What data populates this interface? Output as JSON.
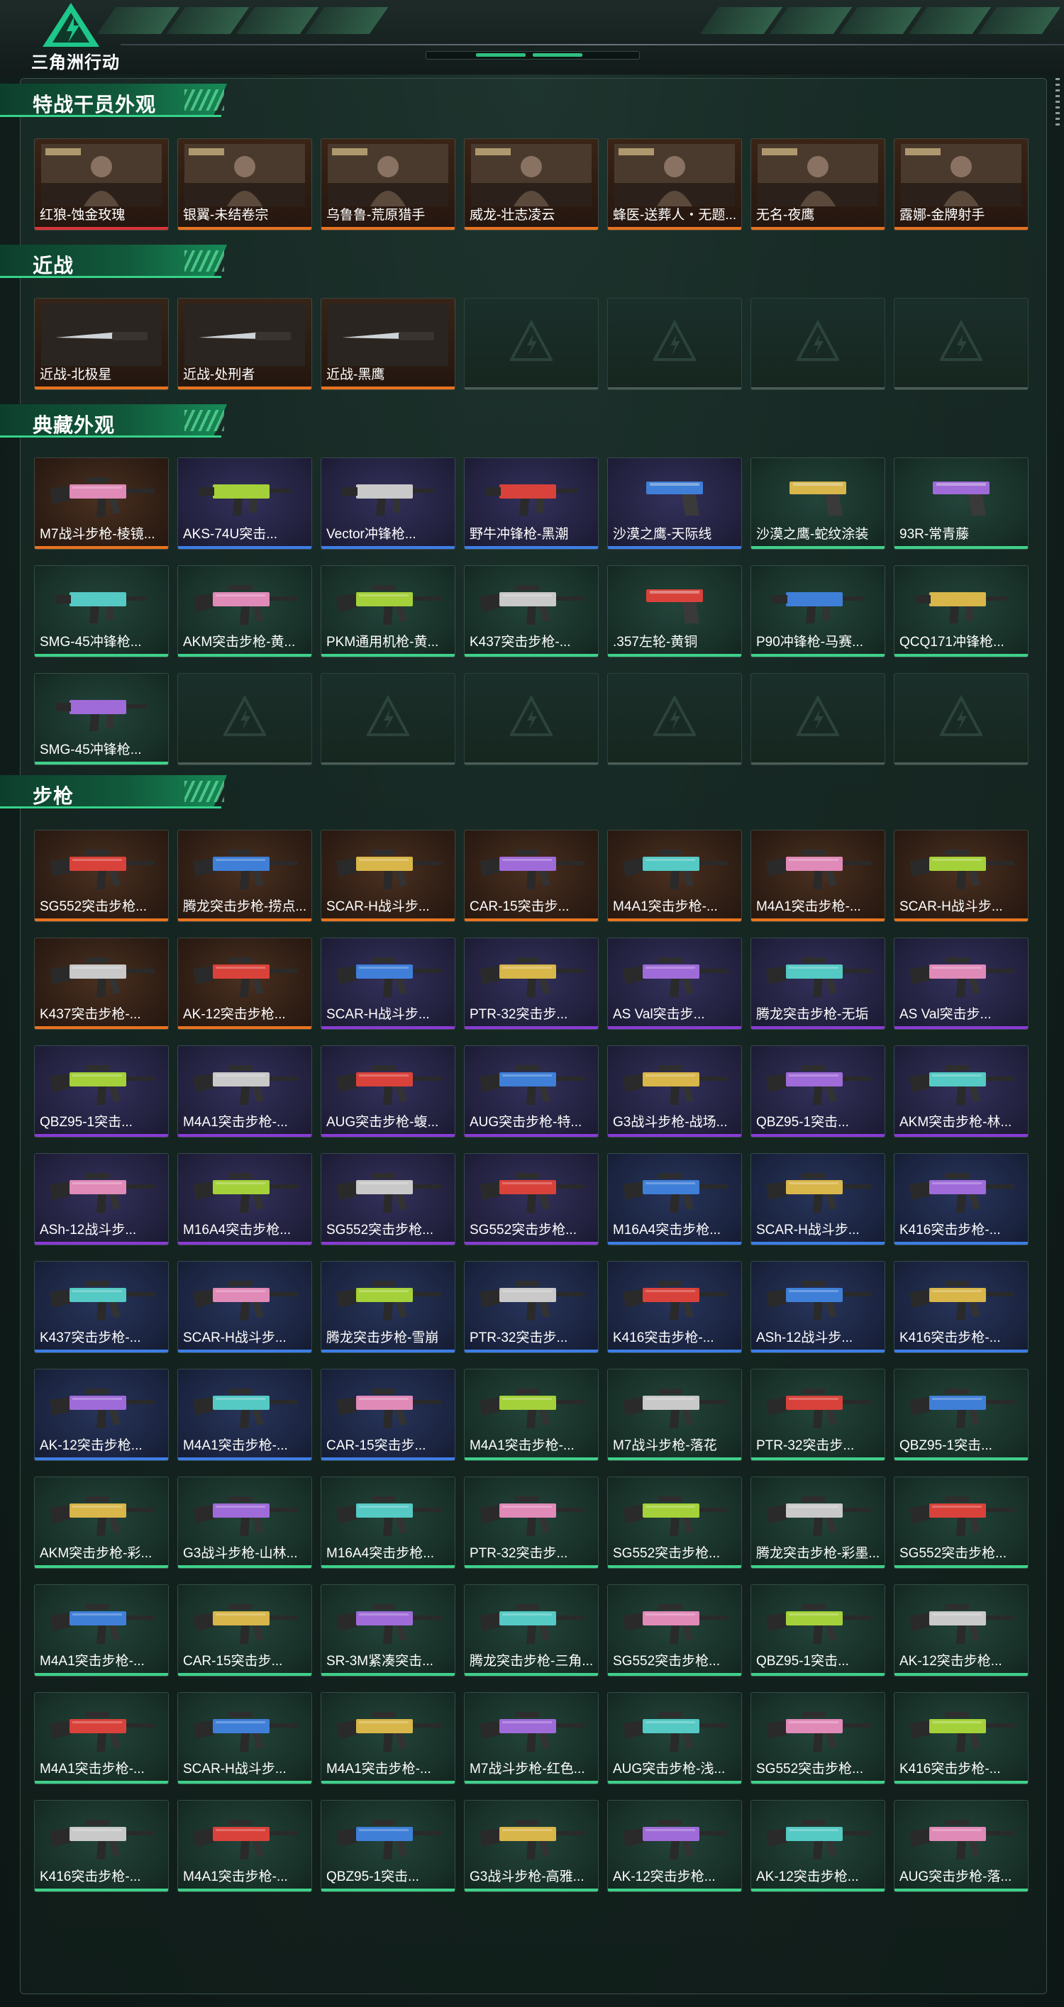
{
  "app": {
    "title": "三角洲行动"
  },
  "colors": {
    "gold": "#e8731f",
    "purple": "#8a3bd4",
    "blue": "#3d7ee6",
    "green": "#3fd08a",
    "red": "#d8343b"
  },
  "sections": [
    {
      "title": "特战干员外观",
      "items": [
        {
          "label": "红狼-蚀金玫瑰",
          "rarity": "red",
          "bg": "ops",
          "icon": "operator-portrait-icon"
        },
        {
          "label": "银翼-未结卷宗",
          "rarity": "gold",
          "bg": "ops",
          "icon": "operator-portrait-icon"
        },
        {
          "label": "乌鲁鲁-荒原猎手",
          "rarity": "gold",
          "bg": "ops",
          "icon": "operator-portrait-icon"
        },
        {
          "label": "威龙-壮志凌云",
          "rarity": "gold",
          "bg": "ops",
          "icon": "operator-portrait-icon"
        },
        {
          "label": "蜂医-送葬人・无题...",
          "rarity": "gold",
          "bg": "ops",
          "icon": "operator-portrait-icon"
        },
        {
          "label": "无名-夜鹰",
          "rarity": "gold",
          "bg": "ops",
          "icon": "operator-portrait-icon"
        },
        {
          "label": "露娜-金牌射手",
          "rarity": "gold",
          "bg": "ops",
          "icon": "operator-portrait-icon"
        }
      ]
    },
    {
      "title": "近战",
      "items": [
        {
          "label": "近战-北极星",
          "rarity": "gold",
          "bg": "melee",
          "icon": "knife-icon"
        },
        {
          "label": "近战-处刑者",
          "rarity": "gold",
          "bg": "melee",
          "icon": "knife-icon"
        },
        {
          "label": "近战-黑鹰",
          "rarity": "gold",
          "bg": "melee",
          "icon": "knife-icon"
        },
        {
          "empty": true
        },
        {
          "empty": true
        },
        {
          "empty": true
        },
        {
          "empty": true
        }
      ]
    },
    {
      "title": "典藏外观",
      "items": [
        {
          "label": "M7战斗步枪-棱镜...",
          "rarity": "gold",
          "bg": "gold",
          "icon": "rifle-icon"
        },
        {
          "label": "AKS-74U突击...",
          "rarity": "blue",
          "bg": "purple",
          "icon": "smg-icon"
        },
        {
          "label": "Vector冲锋枪...",
          "rarity": "blue",
          "bg": "purple",
          "icon": "smg-icon"
        },
        {
          "label": "野牛冲锋枪-黑潮",
          "rarity": "blue",
          "bg": "purple",
          "icon": "smg-icon"
        },
        {
          "label": "沙漠之鹰-天际线",
          "rarity": "blue",
          "bg": "purple",
          "icon": "pistol-icon"
        },
        {
          "label": "沙漠之鹰-蛇纹涂装",
          "rarity": "green",
          "bg": "green",
          "icon": "pistol-icon"
        },
        {
          "label": "93R-常青藤",
          "rarity": "green",
          "bg": "green",
          "icon": "pistol-icon"
        },
        {
          "label": "SMG-45冲锋枪...",
          "rarity": "green",
          "bg": "green",
          "icon": "smg-icon"
        },
        {
          "label": "AKM突击步枪-黄...",
          "rarity": "green",
          "bg": "green",
          "icon": "rifle-icon"
        },
        {
          "label": "PKM通用机枪-黄...",
          "rarity": "green",
          "bg": "green",
          "icon": "rifle-icon"
        },
        {
          "label": "K437突击步枪-...",
          "rarity": "green",
          "bg": "green",
          "icon": "rifle-icon"
        },
        {
          "label": ".357左轮-黄铜",
          "rarity": "green",
          "bg": "green",
          "icon": "revolver-icon"
        },
        {
          "label": "P90冲锋枪-马赛...",
          "rarity": "green",
          "bg": "green",
          "icon": "smg-icon"
        },
        {
          "label": "QCQ171冲锋枪...",
          "rarity": "green",
          "bg": "green",
          "icon": "smg-icon"
        },
        {
          "label": "SMG-45冲锋枪...",
          "rarity": "green",
          "bg": "green",
          "icon": "smg-icon"
        },
        {
          "empty": true
        },
        {
          "empty": true
        },
        {
          "empty": true
        },
        {
          "empty": true
        },
        {
          "empty": true
        },
        {
          "empty": true
        }
      ]
    },
    {
      "title": "步枪",
      "items": [
        {
          "label": "SG552突击步枪...",
          "rarity": "gold",
          "bg": "gold",
          "icon": "rifle-icon"
        },
        {
          "label": "腾龙突击步枪-捞点...",
          "rarity": "gold",
          "bg": "gold",
          "icon": "rifle-icon"
        },
        {
          "label": "SCAR-H战斗步...",
          "rarity": "gold",
          "bg": "gold",
          "icon": "rifle-icon"
        },
        {
          "label": "CAR-15突击步...",
          "rarity": "gold",
          "bg": "gold",
          "icon": "rifle-icon"
        },
        {
          "label": "M4A1突击步枪-...",
          "rarity": "gold",
          "bg": "gold",
          "icon": "rifle-icon"
        },
        {
          "label": "M4A1突击步枪-...",
          "rarity": "gold",
          "bg": "gold",
          "icon": "rifle-icon"
        },
        {
          "label": "SCAR-H战斗步...",
          "rarity": "gold",
          "bg": "gold",
          "icon": "rifle-icon"
        },
        {
          "label": "K437突击步枪-...",
          "rarity": "gold",
          "bg": "gold",
          "icon": "rifle-icon"
        },
        {
          "label": "AK-12突击步枪...",
          "rarity": "gold",
          "bg": "gold",
          "icon": "rifle-icon"
        },
        {
          "label": "SCAR-H战斗步...",
          "rarity": "purple",
          "bg": "purple",
          "icon": "rifle-icon"
        },
        {
          "label": "PTR-32突击步...",
          "rarity": "purple",
          "bg": "purple",
          "icon": "rifle-icon"
        },
        {
          "label": "AS Val突击步...",
          "rarity": "purple",
          "bg": "purple",
          "icon": "rifle-icon"
        },
        {
          "label": "腾龙突击步枪-无垢",
          "rarity": "purple",
          "bg": "purple",
          "icon": "rifle-icon"
        },
        {
          "label": "AS Val突击步...",
          "rarity": "purple",
          "bg": "purple",
          "icon": "rifle-icon"
        },
        {
          "label": "QBZ95-1突击...",
          "rarity": "purple",
          "bg": "purple",
          "icon": "rifle-icon"
        },
        {
          "label": "M4A1突击步枪-...",
          "rarity": "purple",
          "bg": "purple",
          "icon": "rifle-icon"
        },
        {
          "label": "AUG突击步枪-蝮...",
          "rarity": "purple",
          "bg": "purple",
          "icon": "rifle-icon"
        },
        {
          "label": "AUG突击步枪-特...",
          "rarity": "purple",
          "bg": "purple",
          "icon": "rifle-icon"
        },
        {
          "label": "G3战斗步枪-战场...",
          "rarity": "purple",
          "bg": "purple",
          "icon": "rifle-icon"
        },
        {
          "label": "QBZ95-1突击...",
          "rarity": "purple",
          "bg": "purple",
          "icon": "rifle-icon"
        },
        {
          "label": "AKM突击步枪-林...",
          "rarity": "purple",
          "bg": "purple",
          "icon": "rifle-icon"
        },
        {
          "label": "ASh-12战斗步...",
          "rarity": "purple",
          "bg": "purple",
          "icon": "rifle-icon"
        },
        {
          "label": "M16A4突击步枪...",
          "rarity": "purple",
          "bg": "purple",
          "icon": "rifle-icon"
        },
        {
          "label": "SG552突击步枪...",
          "rarity": "purple",
          "bg": "purple",
          "icon": "rifle-icon"
        },
        {
          "label": "SG552突击步枪...",
          "rarity": "purple",
          "bg": "purple",
          "icon": "rifle-icon"
        },
        {
          "label": "M16A4突击步枪...",
          "rarity": "blue",
          "bg": "blue",
          "icon": "rifle-icon"
        },
        {
          "label": "SCAR-H战斗步...",
          "rarity": "blue",
          "bg": "blue",
          "icon": "rifle-icon"
        },
        {
          "label": "K416突击步枪-...",
          "rarity": "blue",
          "bg": "blue",
          "icon": "rifle-icon"
        },
        {
          "label": "K437突击步枪-...",
          "rarity": "blue",
          "bg": "blue",
          "icon": "rifle-icon"
        },
        {
          "label": "SCAR-H战斗步...",
          "rarity": "blue",
          "bg": "blue",
          "icon": "rifle-icon"
        },
        {
          "label": "腾龙突击步枪-雪崩",
          "rarity": "blue",
          "bg": "blue",
          "icon": "rifle-icon"
        },
        {
          "label": "PTR-32突击步...",
          "rarity": "blue",
          "bg": "blue",
          "icon": "rifle-icon"
        },
        {
          "label": "K416突击步枪-...",
          "rarity": "blue",
          "bg": "blue",
          "icon": "rifle-icon"
        },
        {
          "label": "ASh-12战斗步...",
          "rarity": "blue",
          "bg": "blue",
          "icon": "rifle-icon"
        },
        {
          "label": "K416突击步枪-...",
          "rarity": "blue",
          "bg": "blue",
          "icon": "rifle-icon"
        },
        {
          "label": "AK-12突击步枪...",
          "rarity": "blue",
          "bg": "blue",
          "icon": "rifle-icon"
        },
        {
          "label": "M4A1突击步枪-...",
          "rarity": "blue",
          "bg": "blue",
          "icon": "rifle-icon"
        },
        {
          "label": "CAR-15突击步...",
          "rarity": "blue",
          "bg": "blue",
          "icon": "rifle-icon"
        },
        {
          "label": "M4A1突击步枪-...",
          "rarity": "green",
          "bg": "green",
          "icon": "rifle-icon"
        },
        {
          "label": "M7战斗步枪-落花",
          "rarity": "green",
          "bg": "green",
          "icon": "rifle-icon"
        },
        {
          "label": "PTR-32突击步...",
          "rarity": "green",
          "bg": "green",
          "icon": "rifle-icon"
        },
        {
          "label": "QBZ95-1突击...",
          "rarity": "green",
          "bg": "green",
          "icon": "rifle-icon"
        },
        {
          "label": "AKM突击步枪-彩...",
          "rarity": "green",
          "bg": "green",
          "icon": "rifle-icon"
        },
        {
          "label": "G3战斗步枪-山林...",
          "rarity": "green",
          "bg": "green",
          "icon": "rifle-icon"
        },
        {
          "label": "M16A4突击步枪...",
          "rarity": "green",
          "bg": "green",
          "icon": "rifle-icon"
        },
        {
          "label": "PTR-32突击步...",
          "rarity": "green",
          "bg": "green",
          "icon": "rifle-icon"
        },
        {
          "label": "SG552突击步枪...",
          "rarity": "green",
          "bg": "green",
          "icon": "rifle-icon"
        },
        {
          "label": "腾龙突击步枪-彩墨...",
          "rarity": "green",
          "bg": "green",
          "icon": "rifle-icon"
        },
        {
          "label": "SG552突击步枪...",
          "rarity": "green",
          "bg": "green",
          "icon": "rifle-icon"
        },
        {
          "label": "M4A1突击步枪-...",
          "rarity": "green",
          "bg": "green",
          "icon": "rifle-icon"
        },
        {
          "label": "CAR-15突击步...",
          "rarity": "green",
          "bg": "green",
          "icon": "rifle-icon"
        },
        {
          "label": "SR-3M紧凑突击...",
          "rarity": "green",
          "bg": "green",
          "icon": "rifle-icon"
        },
        {
          "label": "腾龙突击步枪-三角...",
          "rarity": "green",
          "bg": "green",
          "icon": "rifle-icon"
        },
        {
          "label": "SG552突击步枪...",
          "rarity": "green",
          "bg": "green",
          "icon": "rifle-icon"
        },
        {
          "label": "QBZ95-1突击...",
          "rarity": "green",
          "bg": "green",
          "icon": "rifle-icon"
        },
        {
          "label": "AK-12突击步枪...",
          "rarity": "green",
          "bg": "green",
          "icon": "rifle-icon"
        },
        {
          "label": "M4A1突击步枪-...",
          "rarity": "green",
          "bg": "green",
          "icon": "rifle-icon"
        },
        {
          "label": "SCAR-H战斗步...",
          "rarity": "green",
          "bg": "green",
          "icon": "rifle-icon"
        },
        {
          "label": "M4A1突击步枪-...",
          "rarity": "green",
          "bg": "green",
          "icon": "rifle-icon"
        },
        {
          "label": "M7战斗步枪-红色...",
          "rarity": "green",
          "bg": "green",
          "icon": "rifle-icon"
        },
        {
          "label": "AUG突击步枪-浅...",
          "rarity": "green",
          "bg": "green",
          "icon": "rifle-icon"
        },
        {
          "label": "SG552突击步枪...",
          "rarity": "green",
          "bg": "green",
          "icon": "rifle-icon"
        },
        {
          "label": "K416突击步枪-...",
          "rarity": "green",
          "bg": "green",
          "icon": "rifle-icon"
        },
        {
          "label": "K416突击步枪-...",
          "rarity": "green",
          "bg": "green",
          "icon": "rifle-icon"
        },
        {
          "label": "M4A1突击步枪-...",
          "rarity": "green",
          "bg": "green",
          "icon": "rifle-icon"
        },
        {
          "label": "QBZ95-1突击...",
          "rarity": "green",
          "bg": "green",
          "icon": "rifle-icon"
        },
        {
          "label": "G3战斗步枪-高雅...",
          "rarity": "green",
          "bg": "green",
          "icon": "rifle-icon"
        },
        {
          "label": "AK-12突击步枪...",
          "rarity": "green",
          "bg": "green",
          "icon": "rifle-icon"
        },
        {
          "label": "AK-12突击步枪...",
          "rarity": "green",
          "bg": "green",
          "icon": "rifle-icon"
        },
        {
          "label": "AUG突击步枪-落...",
          "rarity": "green",
          "bg": "green",
          "icon": "rifle-icon"
        }
      ]
    }
  ]
}
